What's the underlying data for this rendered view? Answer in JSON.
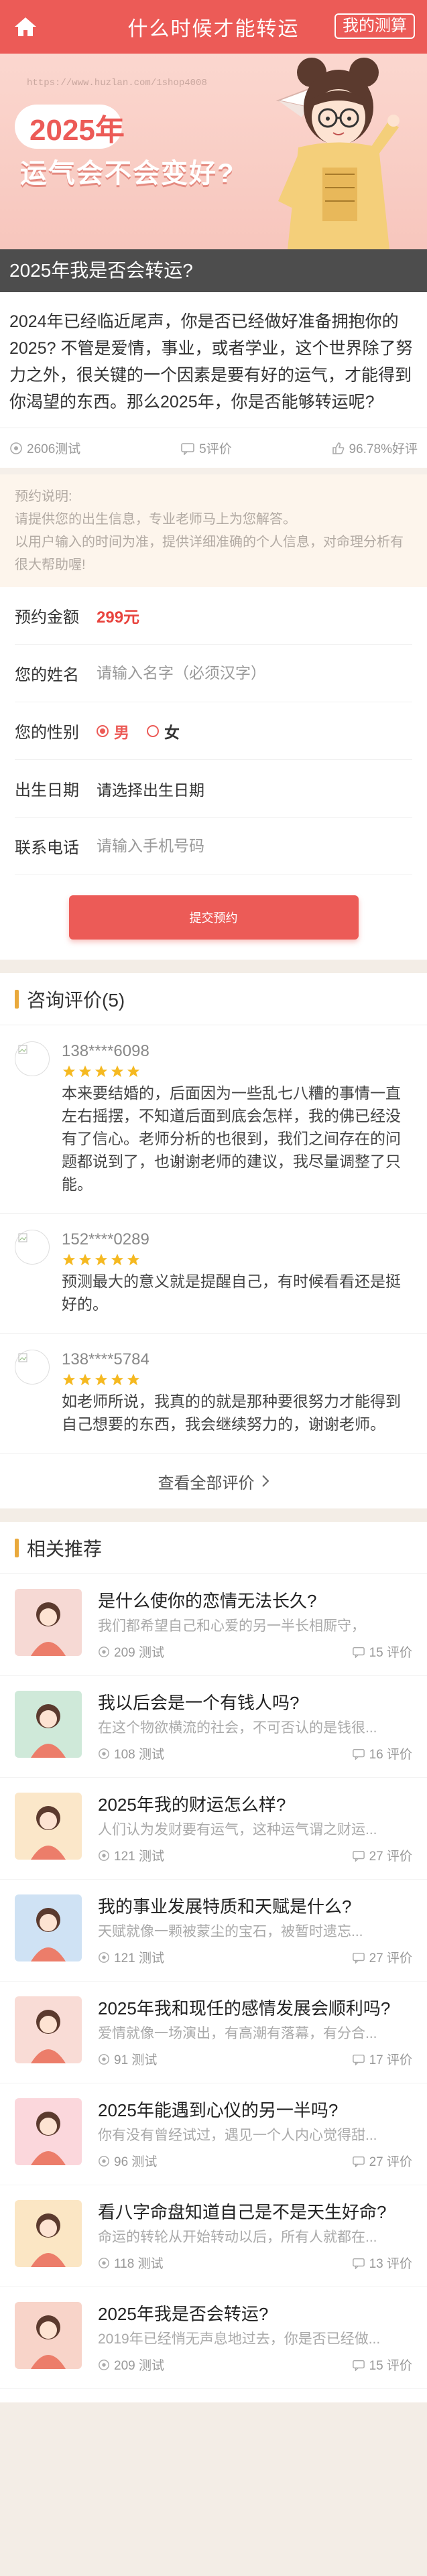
{
  "header": {
    "title": "什么时候才能转运",
    "my_test": "我的测算"
  },
  "banner": {
    "watermark": "https://www.huzlan.com/1shop4008",
    "year": "2025年",
    "slogan": "运气会不会变好?"
  },
  "article": {
    "title": "2025年我是否会转运?",
    "intro": "2024年已经临近尾声，你是否已经做好准备拥抱你的2025? 不管是爱情，事业，或者学业，这个世界除了努力之外，很关键的一个因素是要有好的运气，才能得到你渴望的东西。那么2025年，你是否能够转运呢?",
    "tests": "2606测试",
    "reviews": "5评价",
    "rate": "96.78%好评"
  },
  "notice": {
    "title": "预约说明:",
    "lines": [
      "请提供您的出生信息，专业老师马上为您解答。",
      "以用户输入的时间为准，提供详细准确的个人信息，对命理分析有很大帮助喔!"
    ]
  },
  "form": {
    "price_label": "预约金额",
    "price": "299元",
    "name_label": "您的姓名",
    "name_placeholder": "请输入名字（必须汉字）",
    "gender_label": "您的性别",
    "male": "男",
    "female": "女",
    "birth_label": "出生日期",
    "birth_value": "请选择出生日期",
    "phone_label": "联系电话",
    "phone_placeholder": "请输入手机号码",
    "submit": "提交预约"
  },
  "reviews_section": {
    "title": "咨询评价(5)",
    "items": [
      {
        "user": "138****6098",
        "text": "本来要结婚的，后面因为一些乱七八糟的事情一直左右摇摆，不知道后面到底会怎样，我的佛已经没有了信心。老师分析的也很到，我们之间存在的问题都说到了，也谢谢老师的建议，我尽量调整了只能。"
      },
      {
        "user": "152****0289",
        "text": "预测最大的意义就是提醒自己，有时候看看还是挺好的。"
      },
      {
        "user": "138****5784",
        "text": "如老师所说，我真的的就是那种要很努力才能得到自己想要的东西，我会继续努力的，谢谢老师。"
      }
    ],
    "more": "查看全部评价"
  },
  "related": {
    "title": "相关推荐",
    "items": [
      {
        "title": "是什么使你的恋情无法长久?",
        "desc": "我们都希望自己和心爱的另一半长相厮守，",
        "tests": "209 测试",
        "reviews": "15 评价",
        "color": "#f6d9d4"
      },
      {
        "title": "我以后会是一个有钱人吗?",
        "desc": "在这个物欲横流的社会，不可否认的是钱很...",
        "tests": "108 测试",
        "reviews": "16 评价",
        "color": "#cfe9d9"
      },
      {
        "title": "2025年我的财运怎么样?",
        "desc": "人们认为发财要有运气，这种运气谓之财运...",
        "tests": "121 测试",
        "reviews": "27 评价",
        "color": "#fbe7c9"
      },
      {
        "title": "我的事业发展特质和天赋是什么?",
        "desc": "天赋就像一颗被蒙尘的宝石，被暂时遗忘...",
        "tests": "121 测试",
        "reviews": "27 评价",
        "color": "#cfe2f4"
      },
      {
        "title": "2025年我和现任的感情发展会顺利吗?",
        "desc": "爱情就像一场演出，有高潮有落幕，有分合...",
        "tests": "91 测试",
        "reviews": "17 评价",
        "color": "#f9dcd6"
      },
      {
        "title": "2025年能遇到心仪的另一半吗?",
        "desc": "你有没有曾经试过，遇见一个人内心觉得甜...",
        "tests": "96 测试",
        "reviews": "27 评价",
        "color": "#fbd7dc"
      },
      {
        "title": "看八字命盘知道自己是不是天生好命?",
        "desc": "命运的转轮从开始转动以后，所有人就都在...",
        "tests": "118 测试",
        "reviews": "13 评价",
        "color": "#fbe6c4"
      },
      {
        "title": "2025年我是否会转运?",
        "desc": "2019年已经悄无声息地过去，你是否已经做...",
        "tests": "209 测试",
        "reviews": "15 评价",
        "color": "#f8d4c9"
      }
    ]
  }
}
